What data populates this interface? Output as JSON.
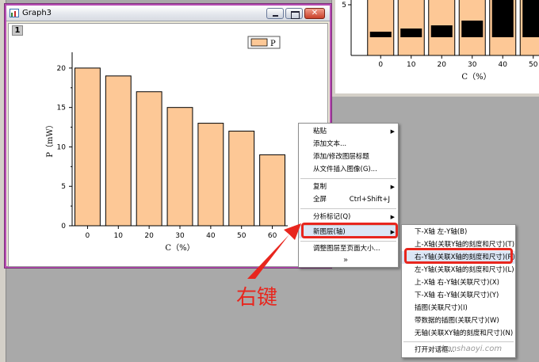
{
  "window": {
    "title": "Graph3",
    "layer_badge": "1",
    "close_glyph": "✕"
  },
  "chart_data": {
    "type": "bar",
    "categories": [
      "0",
      "10",
      "20",
      "30",
      "40",
      "50",
      "60"
    ],
    "values": [
      20,
      19,
      17,
      15,
      13,
      12,
      9
    ],
    "xlabel": "C（%）",
    "ylabel": "P（mW）",
    "ylim": [
      0,
      22
    ],
    "yticks": [
      0,
      5,
      10,
      15,
      20
    ],
    "legend": {
      "label": "P",
      "placement": "top-right"
    },
    "bar_color": "#fdc896",
    "grid": false
  },
  "background_chart": {
    "categories": [
      "0",
      "10",
      "20",
      "30",
      "40",
      "50"
    ],
    "xlabel": "C（%）",
    "ytick": "5",
    "bar_color": "#fdc896",
    "overlay_color": "#000000"
  },
  "context_menu": {
    "items": [
      {
        "label": "粘贴",
        "has_submenu": true
      },
      {
        "label": "添加文本..."
      },
      {
        "label": "添加/修改图层标题"
      },
      {
        "label": "从文件插入图像(G)..."
      },
      {
        "label": "复制",
        "has_submenu": true
      },
      {
        "label": "全屏",
        "shortcut": "Ctrl+Shift+J"
      },
      {
        "label": "分析标记(Q)",
        "has_submenu": true
      },
      {
        "label": "新图层(轴)",
        "has_submenu": true
      },
      {
        "label": "调整图层至页面大小..."
      }
    ],
    "more_glyph": "»"
  },
  "submenu": {
    "items": [
      {
        "label": "下-X轴 左-Y轴(B)"
      },
      {
        "label": "上-X轴(关联Y轴的刻度和尺寸)(T)"
      },
      {
        "label": "右-Y轴(关联X轴的刻度和尺寸)(R)"
      },
      {
        "label": "左-Y轴(关联X轴的刻度和尺寸)(L)"
      },
      {
        "label": "上-X轴 右-Y轴(关联尺寸)(X)"
      },
      {
        "label": "下-X轴 右-Y轴(关联尺寸)(Y)"
      },
      {
        "label": "插图(关联尺寸)(I)"
      },
      {
        "label": "带数据的插图(关联尺寸)(W)"
      },
      {
        "label": "无轴(关联XY轴的刻度和尺寸)(N)"
      },
      {
        "label": "打开对话框..."
      }
    ]
  },
  "annotation": {
    "label": "右键",
    "color": "#e8261e"
  },
  "watermark": "zhanshaoyi.com"
}
